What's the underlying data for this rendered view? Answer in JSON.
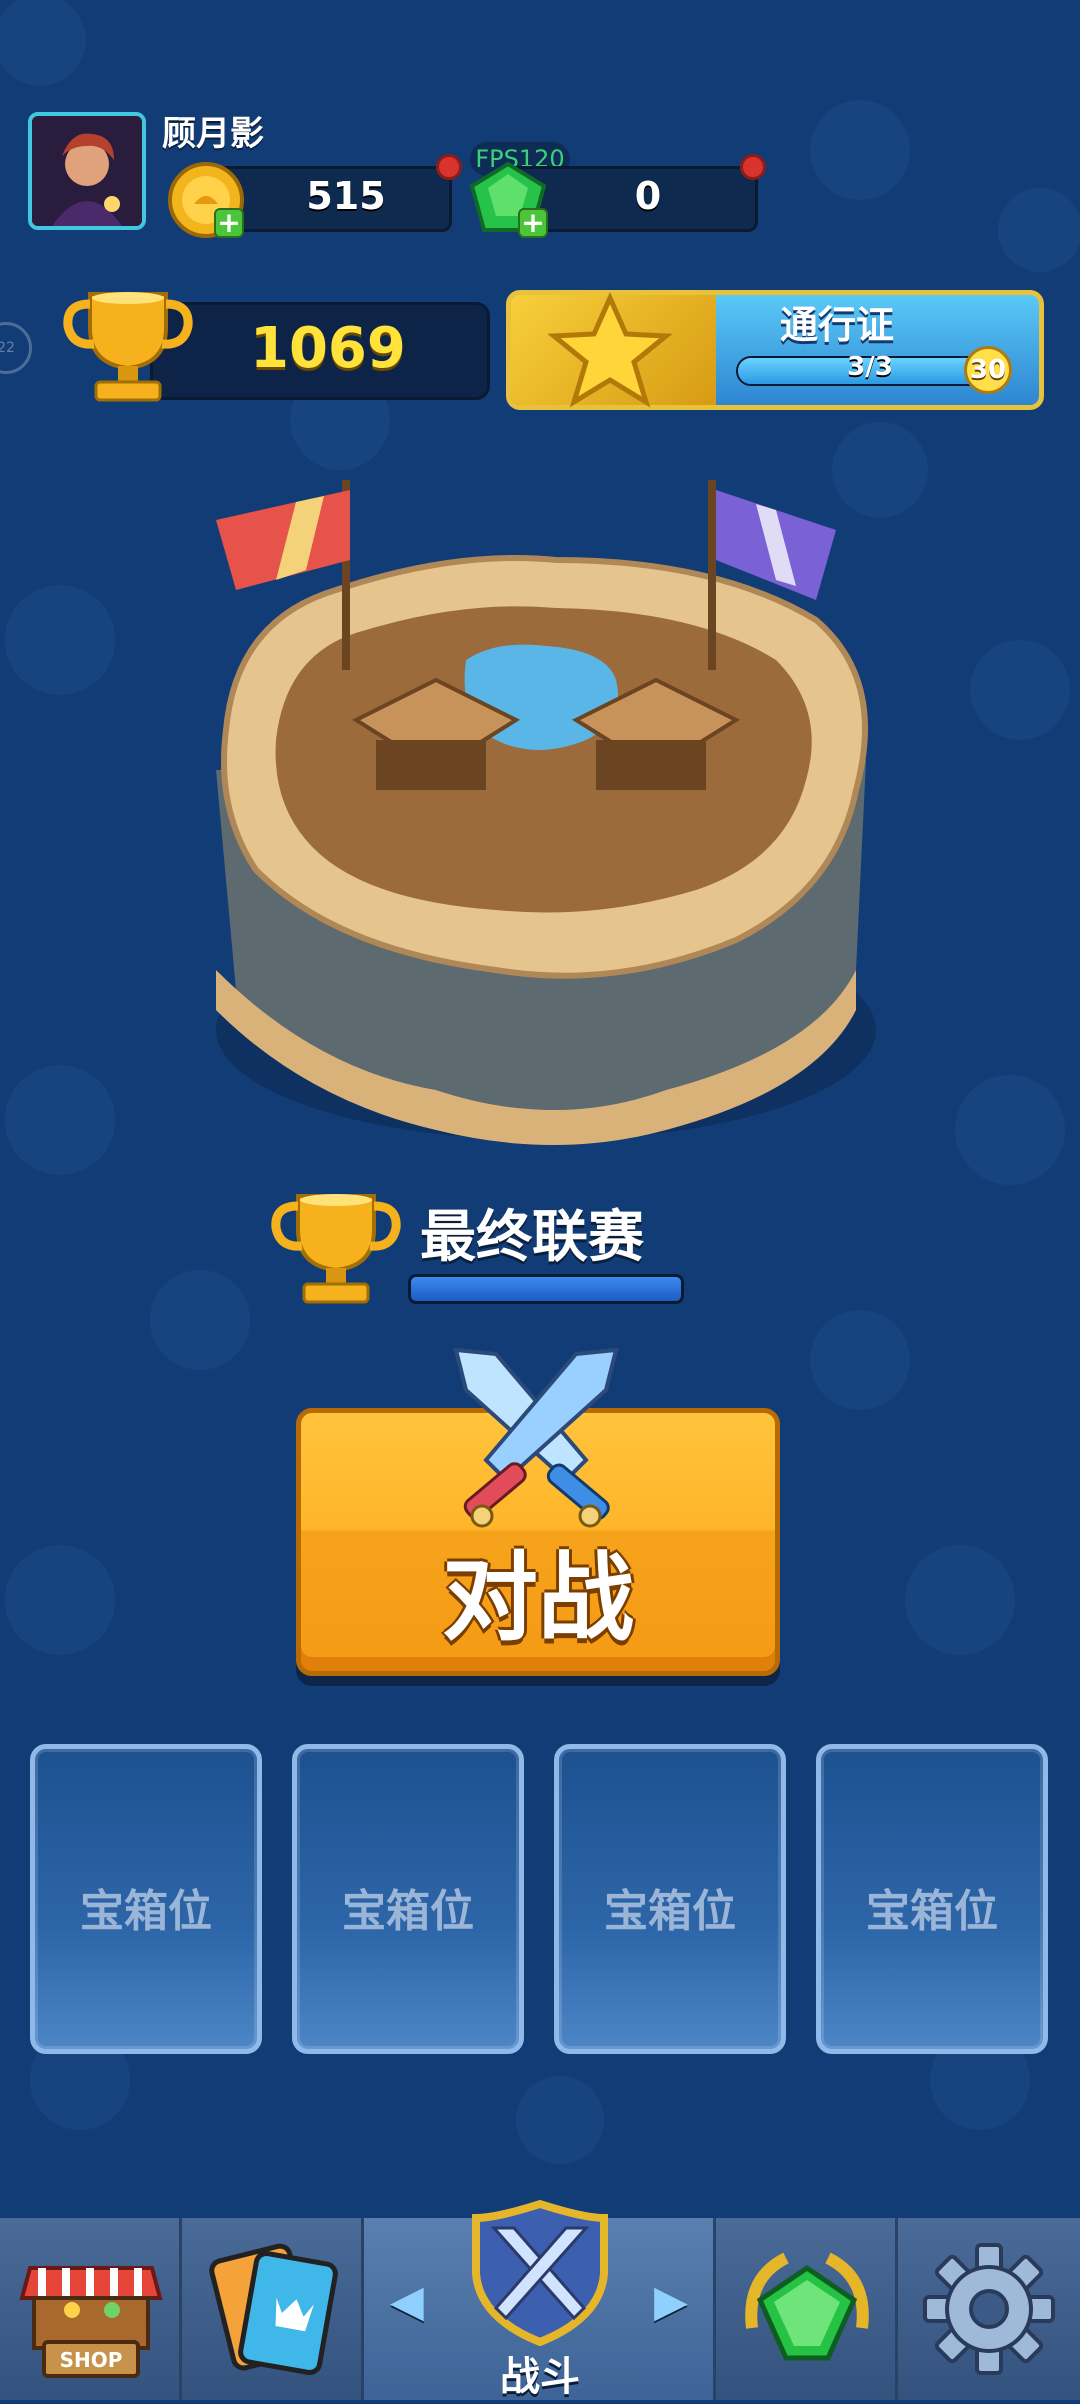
{
  "player": {
    "name": "顾月影"
  },
  "resources": {
    "coins": "515",
    "gems": "0",
    "fps": "FPS120"
  },
  "trophies": {
    "count": "1069"
  },
  "pass": {
    "title": "通行证",
    "progress_text": "3/3",
    "progress_fraction": 1.0,
    "level": "30"
  },
  "side_badge": "22",
  "league": {
    "name": "最终联赛",
    "progress_fraction": 1.0
  },
  "battle_button": {
    "label": "对战"
  },
  "chest_slots": [
    {
      "label": "宝箱位"
    },
    {
      "label": "宝箱位"
    },
    {
      "label": "宝箱位"
    },
    {
      "label": "宝箱位"
    }
  ],
  "bottom_nav": {
    "shop_sign": "SHOP",
    "battle_label": "战斗",
    "left_arrow": "◀",
    "right_arrow": "▶"
  },
  "colors": {
    "accent_gold": "#ffe23a",
    "battle_orange": "#ffb52a",
    "background": "#123c75"
  }
}
